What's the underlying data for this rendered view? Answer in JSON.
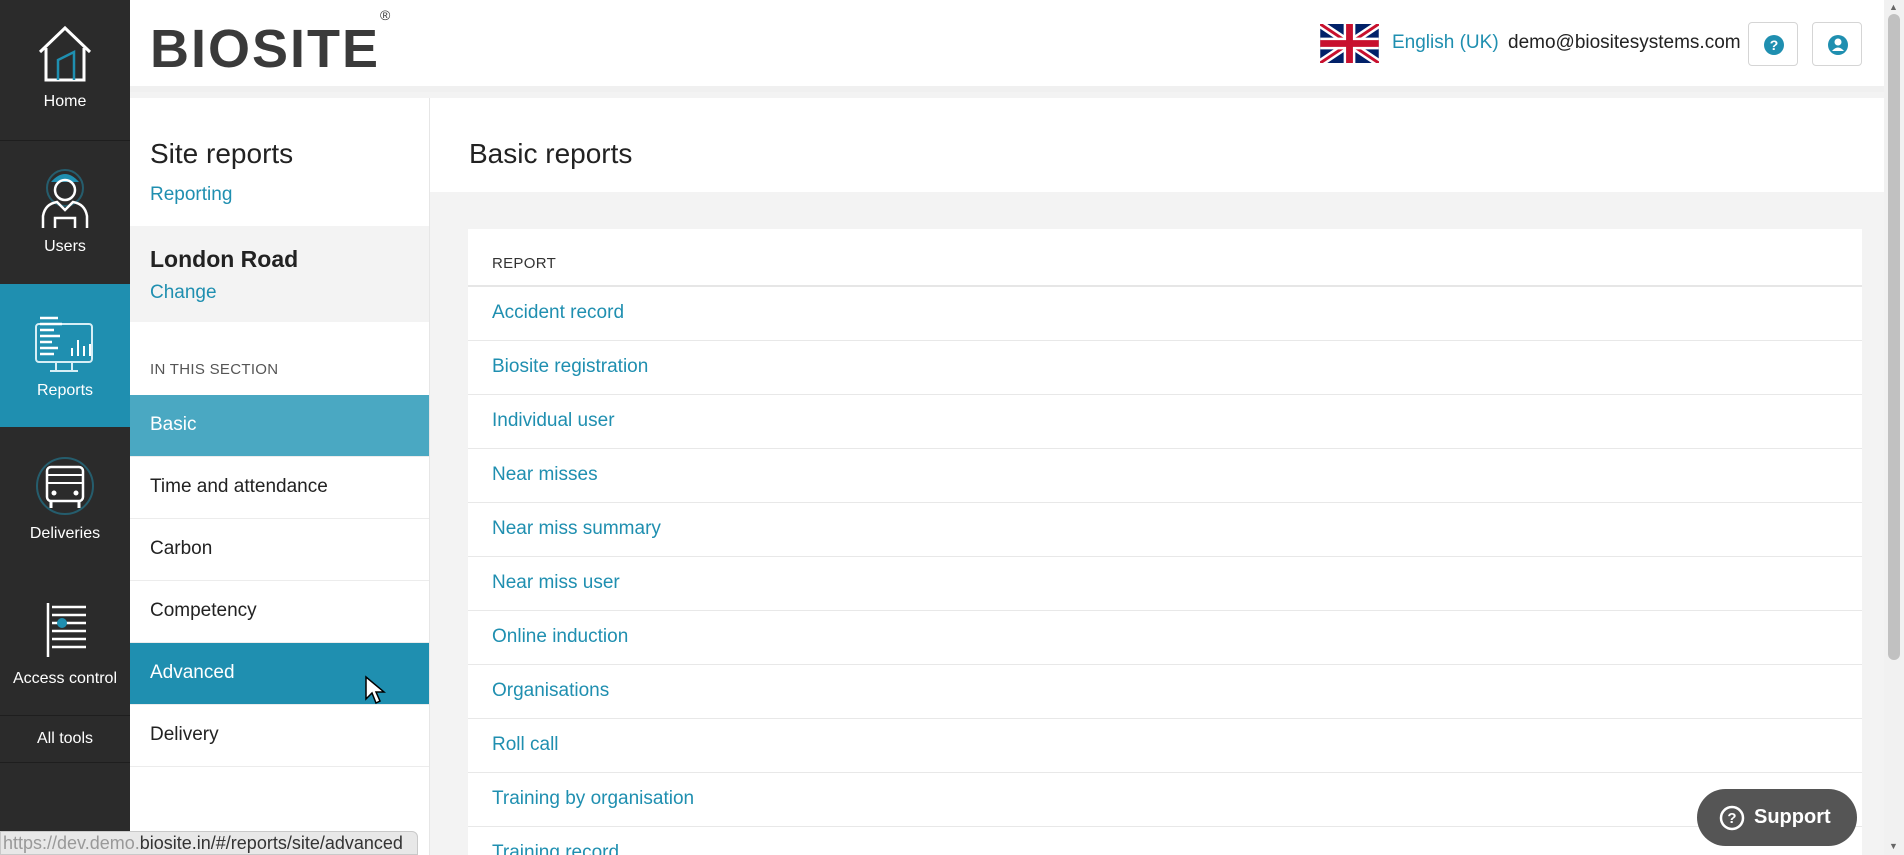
{
  "nav": {
    "home": "Home",
    "users": "Users",
    "reports": "Reports",
    "deliveries": "Deliveries",
    "access_control": "Access control",
    "all_tools": "All tools"
  },
  "header": {
    "logo": "BIOSITE",
    "logo_mark": "®",
    "language": "English (UK)",
    "email": "demo@biositesystems.com",
    "help_icon": "question-circle-icon",
    "user_icon": "user-circle-icon"
  },
  "sidebar": {
    "title": "Site reports",
    "subtitle": "Reporting",
    "site_name": "London Road",
    "site_change": "Change",
    "section_label": "IN THIS SECTION",
    "items": [
      {
        "label": "Basic"
      },
      {
        "label": "Time and attendance"
      },
      {
        "label": "Carbon"
      },
      {
        "label": "Competency"
      },
      {
        "label": "Advanced"
      },
      {
        "label": "Delivery"
      }
    ]
  },
  "main": {
    "title": "Basic reports",
    "column_header": "REPORT",
    "rows": [
      "Accident record",
      "Biosite registration",
      "Individual user",
      "Near misses",
      "Near miss summary",
      "Near miss user",
      "Online induction",
      "Organisations",
      "Roll call",
      "Training by organisation",
      "Training record"
    ]
  },
  "support": {
    "label": "Support"
  },
  "status_bar": {
    "url_prefix": "https://dev.demo.",
    "url_rest": "biosite.in/#/reports/site/advanced"
  },
  "colors": {
    "accent": "#1f8fb0",
    "active_light": "#4aa8c2",
    "nav_bg": "#2b2b2b"
  }
}
